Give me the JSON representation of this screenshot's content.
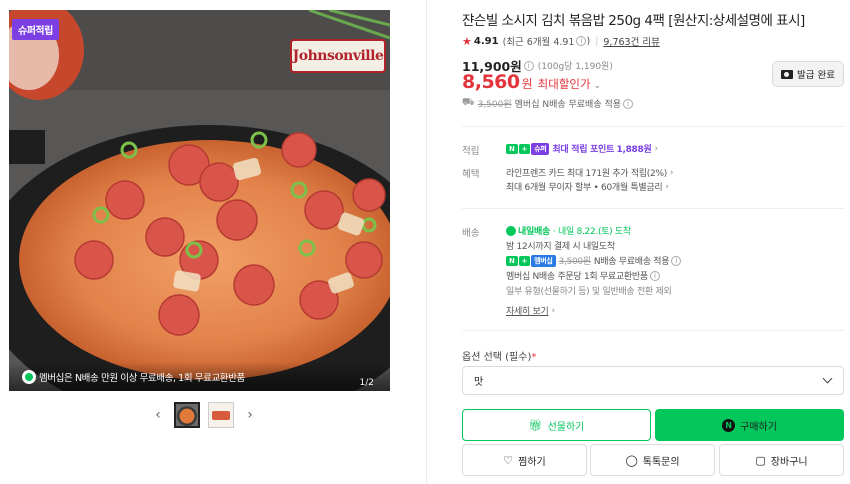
{
  "gallery": {
    "badge": "슈퍼적립",
    "brand_logo_text": "Johnsonville",
    "banner_text": "멤버십은 N배송 만원 이상 무료배송, 1회 무료교환반품",
    "page_counter": "1/2",
    "thumb_prev_icon": "chevron-left-icon",
    "thumb_next_icon": "chevron-right-icon"
  },
  "product": {
    "title": "쟌슨빌 소시지 김치 볶음밥 250g 4팩 [원산지:상세설명에 표시]",
    "rating": "4.91",
    "rating_recent": "(최근 6개월 4.91",
    "rating_recent_close": ")",
    "review_count": "9,763건 리뷰",
    "original_price": "11,900원",
    "unit_price": "(100g당 1,190원)",
    "sale_price": "8,560",
    "sale_won": "원",
    "sale_label": "최대할인가",
    "coupon_button": "발급 완료",
    "shipping_strike": "3,500원",
    "shipping_text": "멤버십 N배송 무료배송 적용"
  },
  "specs": {
    "points_label": "적립",
    "points_tag_n": "N",
    "points_tag_plus": "+",
    "points_tag_super": "슈퍼",
    "points_text": "최대 적립 포인트",
    "points_value": "1,888원",
    "benefits_label": "혜택",
    "benefit_1": "라인프렌즈 카드 최대 171원 추가 적립(2%)",
    "benefit_2": "최대 6개월 무이자 할부 • 60개월 특별금리",
    "delivery_label": "배송",
    "delivery_tomorrow": "내일배송",
    "delivery_date": "· 내일 8.22.(토) 도착",
    "delivery_cutoff": "밤 12시까지 결제 시 내일도착",
    "delivery_tag_membership": "멤버십",
    "delivery_fee_strike": "3,500원",
    "delivery_fee_text": "N배송 무료배송 적용",
    "delivery_return": "멤버십 N배송 주문당 1회 무료교환반품",
    "delivery_exception": "일부 유형(선물하기 등) 및 일반배송 전환 제외",
    "more_link": "자세히 보기"
  },
  "options": {
    "label": "옵션 선택 (필수)",
    "required_mark": "*",
    "selected_value": "맛"
  },
  "buttons": {
    "gift": "선물하기",
    "buy": "구매하기",
    "wish": "찜하기",
    "talk": "톡톡문의",
    "cart": "장바구니"
  },
  "colors": {
    "naver_green": "#03c75a",
    "sale_red": "#e3343c",
    "super_purple": "#7b3fe4"
  }
}
